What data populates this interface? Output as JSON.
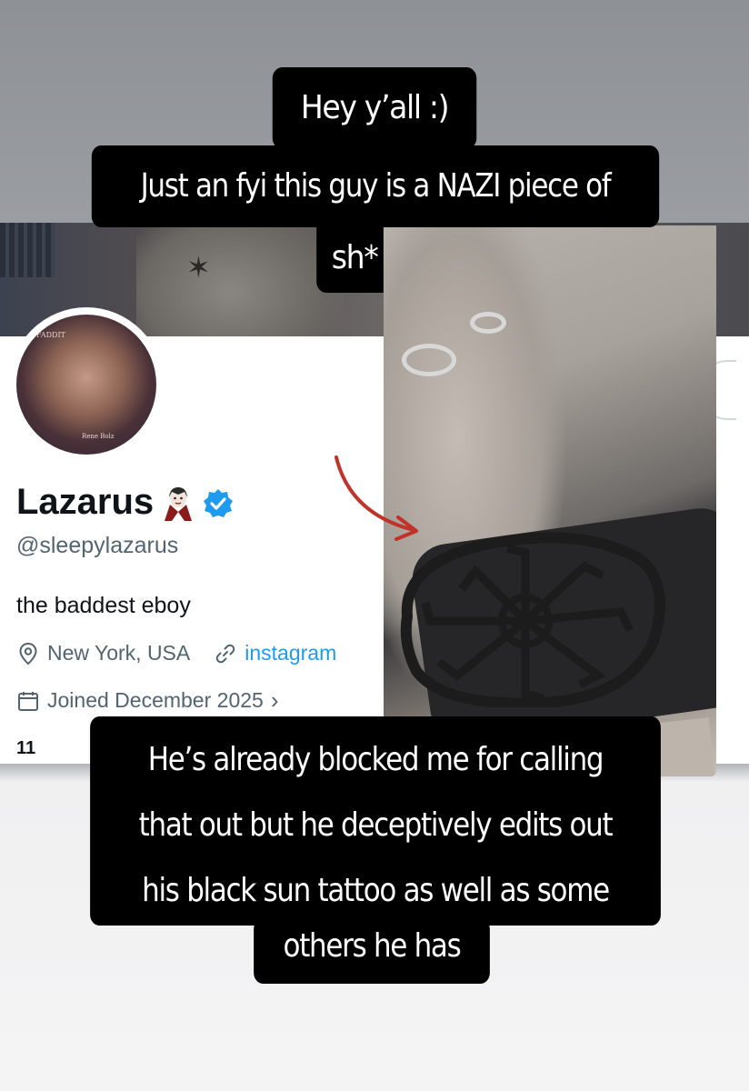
{
  "story": {
    "caption_1": "Hey y’all :)",
    "caption_2": "Just an fyi this guy is a NAZI piece of",
    "caption_3": "sh*",
    "caption_4_line1": "He’s already blocked me for calling",
    "caption_4_line2": "that out but he deceptively edits out",
    "caption_4_line3": "his black sun tattoo as well as some",
    "caption_5": "others he has"
  },
  "profile": {
    "display_name": "Lazarus",
    "name_emoji_icon": "vampire-emoji-icon",
    "verified_icon": "verified-badge-icon",
    "verified_color": "#1d9bf0",
    "handle": "@sleepylazarus",
    "bio": "the baddest eboy",
    "location": "New York, USA",
    "location_icon": "location-pin-icon",
    "website": "instagram",
    "website_icon": "link-icon",
    "joined": "Joined December 2025",
    "joined_icon": "calendar-icon",
    "joined_chevron": "›",
    "stats_partial": "11",
    "avatar_text_top": "FADDIT",
    "avatar_signature": "Rene Bolz"
  },
  "colors": {
    "caption_bg": "#000000",
    "caption_text": "#ffffff",
    "arrow": "#c0332b",
    "link": "#1d9bf0",
    "secondary_text": "#536471"
  }
}
